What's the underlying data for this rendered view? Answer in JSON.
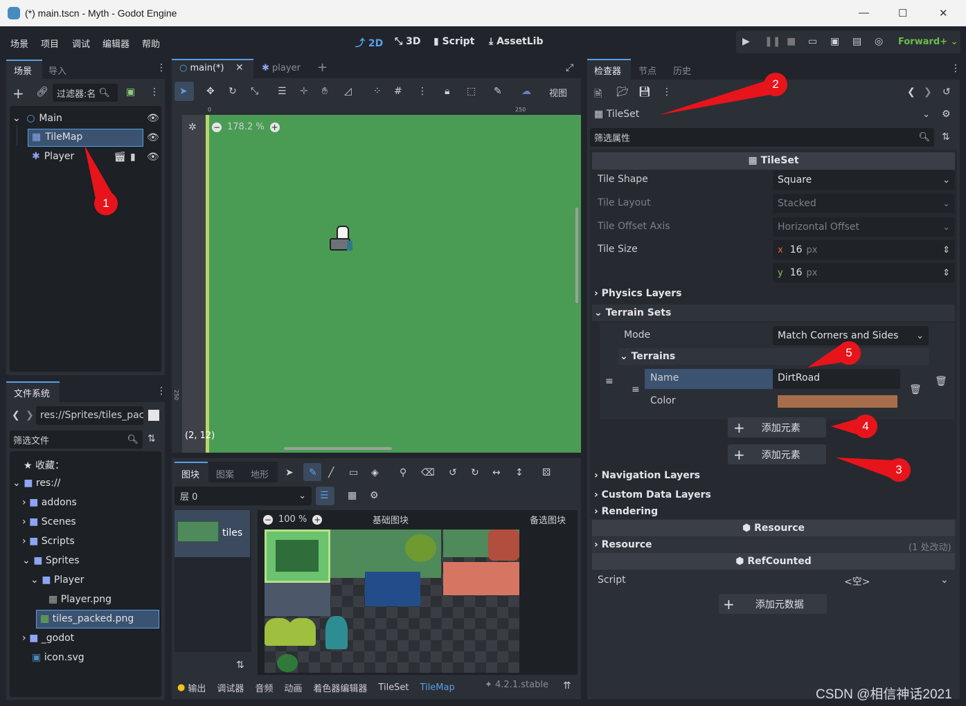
{
  "window": {
    "title": "(*) main.tscn - Myth - Godot Engine",
    "min": "—",
    "max": "☐",
    "close": "✕"
  },
  "menu": [
    "场景",
    "项目",
    "调试",
    "编辑器",
    "帮助"
  ],
  "main_buttons": [
    "2D",
    "3D",
    "Script",
    "AssetLib"
  ],
  "renderer": "Forward+",
  "scene_dock": {
    "tabs": [
      "场景",
      "导入"
    ],
    "filter_placeholder": "过滤器:名",
    "tree": [
      {
        "label": "Main"
      },
      {
        "label": "TileMap"
      },
      {
        "label": "Player"
      }
    ]
  },
  "fs_dock": {
    "tab": "文件系统",
    "path": "res://Sprites/tiles_pac",
    "filter_placeholder": "筛选文件",
    "favorites": "收藏：",
    "items": [
      "res://",
      "addons",
      "Scenes",
      "Scripts",
      "Sprites",
      "Player",
      "Player.png",
      "tiles_packed.png",
      "_godot",
      "icon.svg"
    ]
  },
  "editor_tabs": {
    "main": "main(*)",
    "player": "player",
    "add": "+"
  },
  "viewport": {
    "view_menu": "视图",
    "zoom": "178.2 %",
    "ruler_0": "0",
    "ruler_250": "250",
    "ruler_v250": "250",
    "coords": "(2, 12)"
  },
  "tilemap_panel": {
    "tabs": [
      "图块",
      "图案",
      "地形"
    ],
    "layer": "层 0",
    "tile_source": "tiles",
    "zoom": "100 %",
    "base_tiles": "基础图块",
    "alt_tiles": "备选图块"
  },
  "bottom_tabs": [
    "输出",
    "调试器",
    "音频",
    "动画",
    "着色器编辑器",
    "TileSet",
    "TileMap"
  ],
  "version": "4.2.1.stable",
  "inspector": {
    "tabs": [
      "检查器",
      "节点",
      "历史"
    ],
    "resource": "TileSet",
    "filter_placeholder": "筛选属性",
    "category_tileset": "TileSet",
    "props": [
      {
        "label": "Tile Shape",
        "value": "Square"
      },
      {
        "label": "Tile Layout",
        "value": "Stacked"
      },
      {
        "label": "Tile Offset Axis",
        "value": "Horizontal Offset"
      },
      {
        "label": "Tile Size",
        "x": "16",
        "y": "16",
        "unit": "px"
      }
    ],
    "physics_layers": "Physics Layers",
    "terrain_sets": "Terrain Sets",
    "mode_label": "Mode",
    "mode_value": "Match Corners and Sides",
    "terrains": "Terrains",
    "name_label": "Name",
    "name_value": "DirtRoad",
    "color_label": "Color",
    "terrain_color": "#a86e4c",
    "add_element": "添加元素",
    "navigation_layers": "Navigation Layers",
    "custom_data_layers": "Custom Data Layers",
    "rendering": "Rendering",
    "category_resource": "Resource",
    "resource_section": "Resource",
    "resource_changes": "(1 处改动)",
    "category_refcounted": "RefCounted",
    "script_label": "Script",
    "script_value": "<空>",
    "add_metadata": "添加元数据"
  },
  "annotations": [
    "1",
    "2",
    "3",
    "4",
    "5"
  ],
  "watermark": "CSDN @相信神话2021",
  "colors": {
    "accent": "#57a0e8",
    "grass": "#4a9c54",
    "badge": "#e8141b",
    "renderer": "#6dbd4a"
  }
}
